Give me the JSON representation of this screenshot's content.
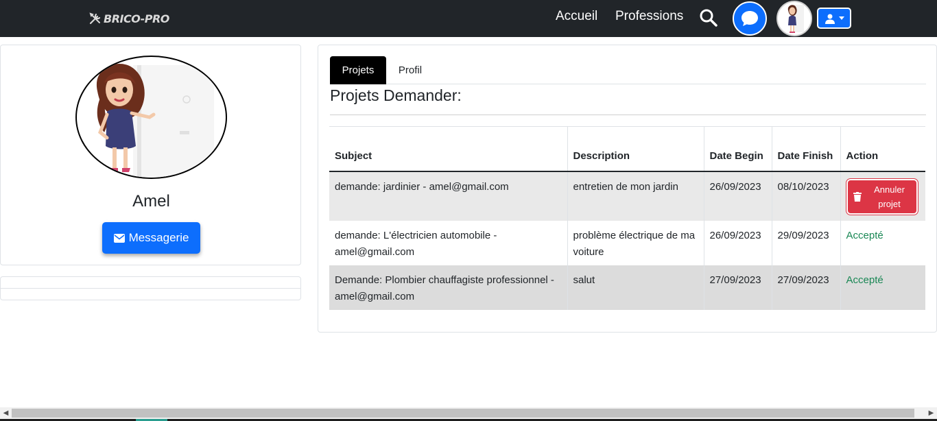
{
  "brand": {
    "name": "BRICO-PRO"
  },
  "nav": {
    "home": "Accueil",
    "professions": "Professions"
  },
  "icons": {
    "brand": "tools-icon",
    "search": "search-icon",
    "chat": "chat-bubble-icon",
    "user": "user-icon",
    "caret": "caret-down-icon",
    "envelope": "envelope-icon",
    "trash": "trash-icon"
  },
  "profile": {
    "name": "Amel",
    "message_button": "Messagerie"
  },
  "tabs": [
    {
      "label": "Projets",
      "active": true
    },
    {
      "label": "Profil",
      "active": false
    }
  ],
  "section_title": "Projets Demander:",
  "table": {
    "headers": [
      "Subject",
      "Description",
      "Date Begin",
      "Date Finish",
      "Action"
    ],
    "rows": [
      {
        "subject": "demande: jardinier - amel@gmail.com",
        "description": "entretien de mon jardin",
        "date_begin": "26/09/2023",
        "date_finish": "08/10/2023",
        "action": "Annuler projet"
      },
      {
        "subject": "demande: L'électricien automobile - amel@gmail.com",
        "description": "problème électrique de ma voiture",
        "date_begin": "26/09/2023",
        "date_finish": "29/09/2023",
        "action": "Accepté"
      },
      {
        "subject": "Demande: Plombier chauffagiste professionnel - amel@gmail.com",
        "description": "salut",
        "date_begin": "27/09/2023",
        "date_finish": "27/09/2023",
        "action": "Accepté"
      }
    ]
  },
  "colors": {
    "navbar": "#212529",
    "primary": "#0d6efd",
    "danger": "#dc3545",
    "success": "#198754"
  }
}
